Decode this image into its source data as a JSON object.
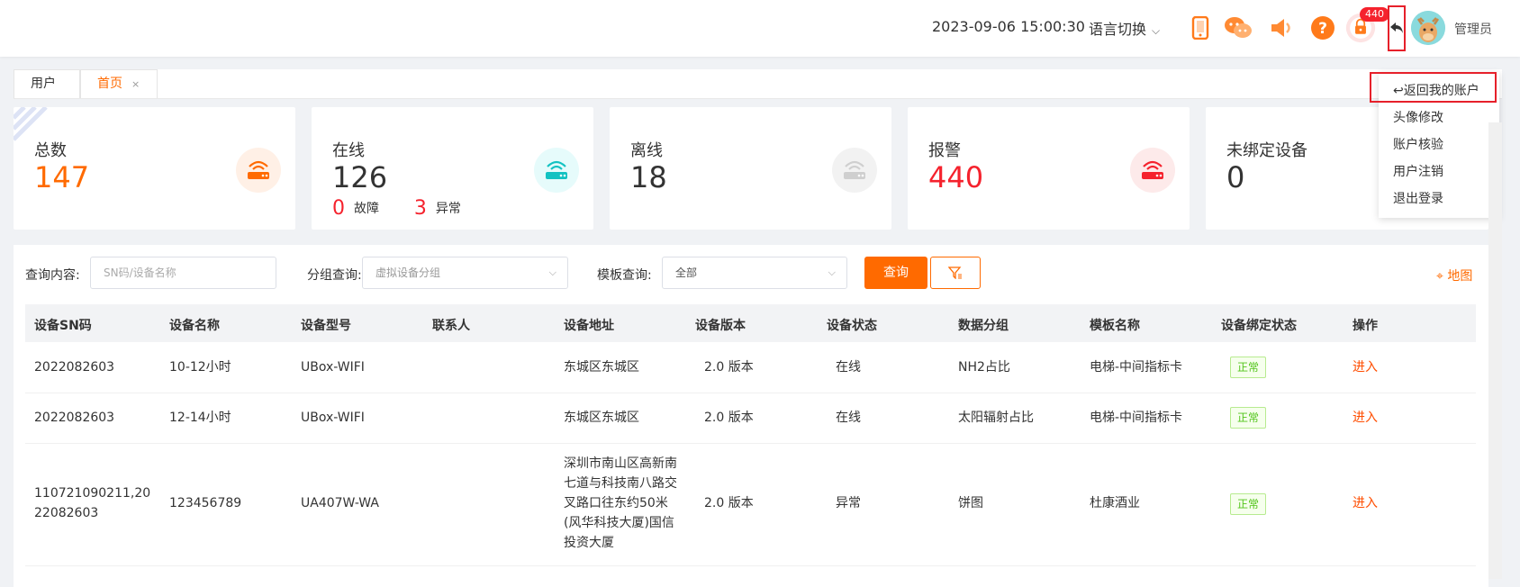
{
  "header": {
    "datetime": "2023-09-06 15:00:30",
    "language_label": "语言切换",
    "alarm_count": "440",
    "username": "管理员",
    "icons": [
      "mobile-icon",
      "wechat-icon",
      "speaker-icon",
      "help-icon",
      "alarm-icon",
      "return-icon"
    ]
  },
  "tabs": [
    {
      "label": "用户",
      "active": false
    },
    {
      "label": "首页",
      "active": true,
      "close": "×"
    }
  ],
  "stats": [
    {
      "label": "总数",
      "value": "147",
      "color": "#ff6a00",
      "icon": "router-icon",
      "icon_color": "#ff6a00",
      "circle_bg": "#fff0e6"
    },
    {
      "label": "在线",
      "value": "126",
      "color": "#333333",
      "icon": "router-icon",
      "icon_color": "#13c2c2",
      "circle_bg": "#e6fbfb",
      "sub": [
        {
          "n": "0",
          "label": "故障"
        },
        {
          "n": "3",
          "label": "异常"
        }
      ]
    },
    {
      "label": "离线",
      "value": "18",
      "color": "#333333",
      "icon": "router-icon",
      "icon_color": "#cfcfcf",
      "circle_bg": "#f2f2f2"
    },
    {
      "label": "报警",
      "value": "440",
      "color": "#f5222d",
      "icon": "router-icon",
      "icon_color": "#f5222d",
      "circle_bg": "#fdeaea"
    },
    {
      "label": "未绑定设备",
      "value": "0",
      "color": "#333333"
    }
  ],
  "dropdown": {
    "return_label": "返回我的账户",
    "items": [
      "头像修改",
      "账户核验",
      "用户注销",
      "退出登录"
    ]
  },
  "filters": {
    "query_label": "查询内容:",
    "query_placeholder": "SN码/设备名称",
    "group_label": "分组查询:",
    "group_value": "虚拟设备分组",
    "template_label": "模板查询:",
    "template_value": "全部",
    "query_button": "查询",
    "map_label": "地图"
  },
  "table": {
    "headers": [
      "设备SN码",
      "设备名称",
      "设备型号",
      "联系人",
      "设备地址",
      "设备版本",
      "设备状态",
      "数据分组",
      "模板名称",
      "设备绑定状态",
      "操作"
    ],
    "rows": [
      {
        "sn": "2022082603",
        "name": "10-12小时",
        "model": "UBox-WIFI",
        "contact": "",
        "address": "东城区东城区",
        "version": "2.0 版本",
        "status": "在线",
        "group": "NH2占比",
        "template": "电梯-中间指标卡",
        "bind": "正常",
        "action": "进入"
      },
      {
        "sn": "2022082603",
        "name": "12-14小时",
        "model": "UBox-WIFI",
        "contact": "",
        "address": "东城区东城区",
        "version": "2.0 版本",
        "status": "在线",
        "group": "太阳辐射占比",
        "template": "电梯-中间指标卡",
        "bind": "正常",
        "action": "进入"
      },
      {
        "sn": "110721090211,2022082603",
        "name": "123456789",
        "model": "UA407W-WA",
        "contact": "",
        "address": "深圳市南山区高新南七道与科技南八路交叉路口往东约50米(风华科技大厦)国信投资大厦",
        "version": "2.0 版本",
        "status": "异常",
        "group": "饼图",
        "template": "杜康酒业",
        "bind": "正常",
        "action": "进入"
      }
    ]
  }
}
